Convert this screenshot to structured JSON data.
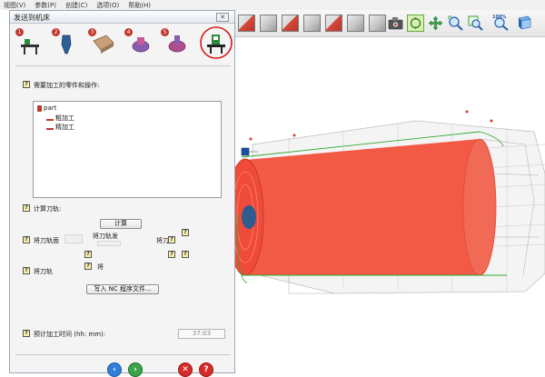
{
  "menubar": {
    "items": [
      "视图(V)",
      "参数(P)",
      "创建(C)",
      "选项(O)",
      "帮助(H)"
    ]
  },
  "dialog": {
    "title": "发送到机床",
    "close_label": "✕",
    "steps": [
      "1",
      "2",
      "3",
      "4",
      "5"
    ],
    "parts_label": "需要加工的零件和操作:",
    "tree": {
      "root": "part",
      "children": [
        "粗加工",
        "精加工"
      ]
    },
    "calc_toolpath_label": "计算刀轨:",
    "calc_button": "计算",
    "toolpath_to_label": "将刀轨面",
    "toolpath_to_2": "将刀轨发",
    "toolpath_to_3": "将刀",
    "toolpath_to_4": "将刀轨",
    "toolpath_to_5": "将",
    "write_nc_button": "写入 NC 程序文件...",
    "est_time_label": "预计加工时间 (hh: mm):",
    "est_time_value": "37:03",
    "toolbar_zoom": "100%"
  },
  "colors": {
    "accent_red": "#d92b2b",
    "workpiece": "#f04a3a",
    "toolpath_green": "#2fa82f",
    "highlight_circle": "#d21f1f"
  }
}
